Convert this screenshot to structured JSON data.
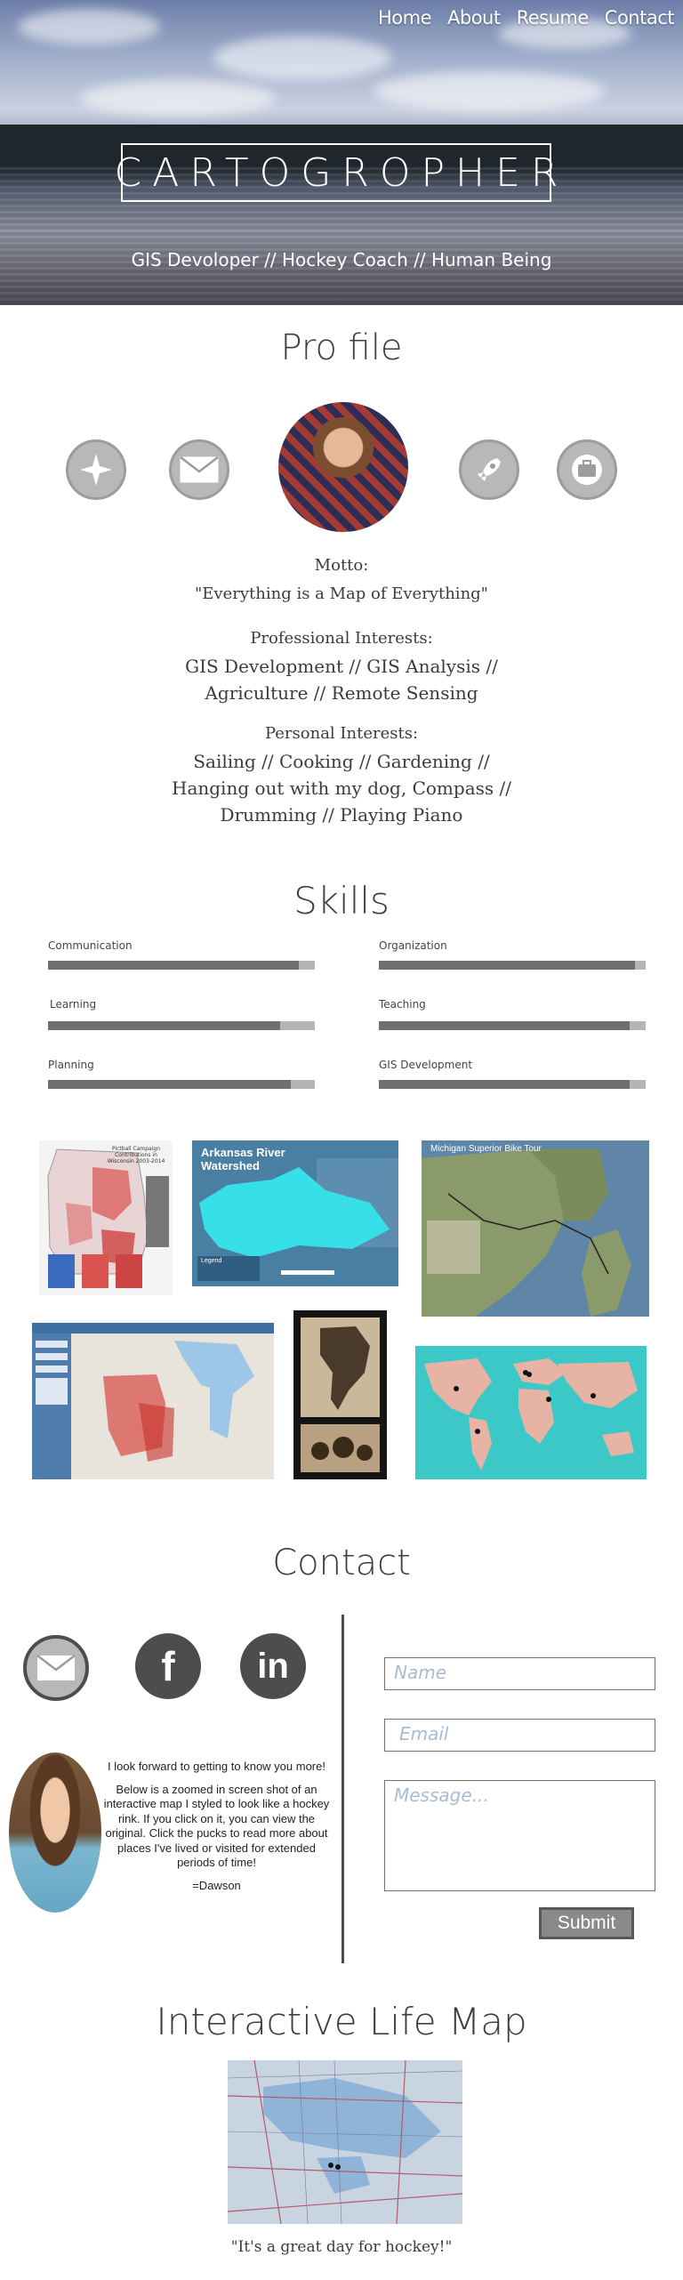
{
  "nav": {
    "items": [
      "Home",
      "About",
      "Resume",
      "Contact"
    ]
  },
  "hero": {
    "brand": "CARTOGROPHER",
    "tagline": "GIS Devoloper // Hockey Coach // Human Being"
  },
  "profile": {
    "title": "Pro file",
    "icons": [
      "compass-star-icon",
      "envelope-icon",
      "rocket-icon",
      "briefcase-icon"
    ],
    "motto_label": "Motto:",
    "motto": "\"Everything is a Map of Everything\"",
    "professional_label": "Professional Interests:",
    "professional_line1": "GIS Development // GIS Analysis //",
    "professional_line2": "Agriculture // Remote Sensing",
    "personal_label": "Personal Interests:",
    "personal_line1": "Sailing // Cooking // Gardening //",
    "personal_line2": "Hanging out with my dog, Compass //",
    "personal_line3": "Drumming // Playing Piano"
  },
  "skills": {
    "title": "Skills",
    "items": [
      {
        "label": "Communication",
        "level": 0.94
      },
      {
        "label": "Organization",
        "level": 0.96
      },
      {
        "label": "Learning",
        "level": 0.87
      },
      {
        "label": "Teaching",
        "level": 0.94
      },
      {
        "label": "Planning",
        "level": 0.91
      },
      {
        "label": "GIS Development",
        "level": 0.94
      }
    ]
  },
  "maps": {
    "wisconsin_title": "Pictball Campaign Contributions in Wisconsin 2003-2014",
    "arkansas_title": "Arkansas River Watershed",
    "arkansas_legend": "Legend",
    "michigan_title": "Michigan Superior Bike Tour"
  },
  "contact": {
    "title": "Contact",
    "name_placeholder": "Name",
    "email_placeholder": "Email",
    "message_placeholder": "Message...",
    "submit": "Submit",
    "note_line1": "I look forward to getting to know you more!",
    "note_body": "Below is a zoomed in screen shot of an interactive map I styled to look like a hockey rink.  If you click on it, you can view the original. Click the pucks to read more about places I've lived or visited for extended periods of time!",
    "signature": "=Dawson"
  },
  "lifemap": {
    "title": "Interactive Life Map",
    "caption": "\"It's a great day for hockey!\""
  },
  "colors": {
    "accent_grey": "#4d4d4d",
    "field_placeholder": "#a7bcd2"
  }
}
